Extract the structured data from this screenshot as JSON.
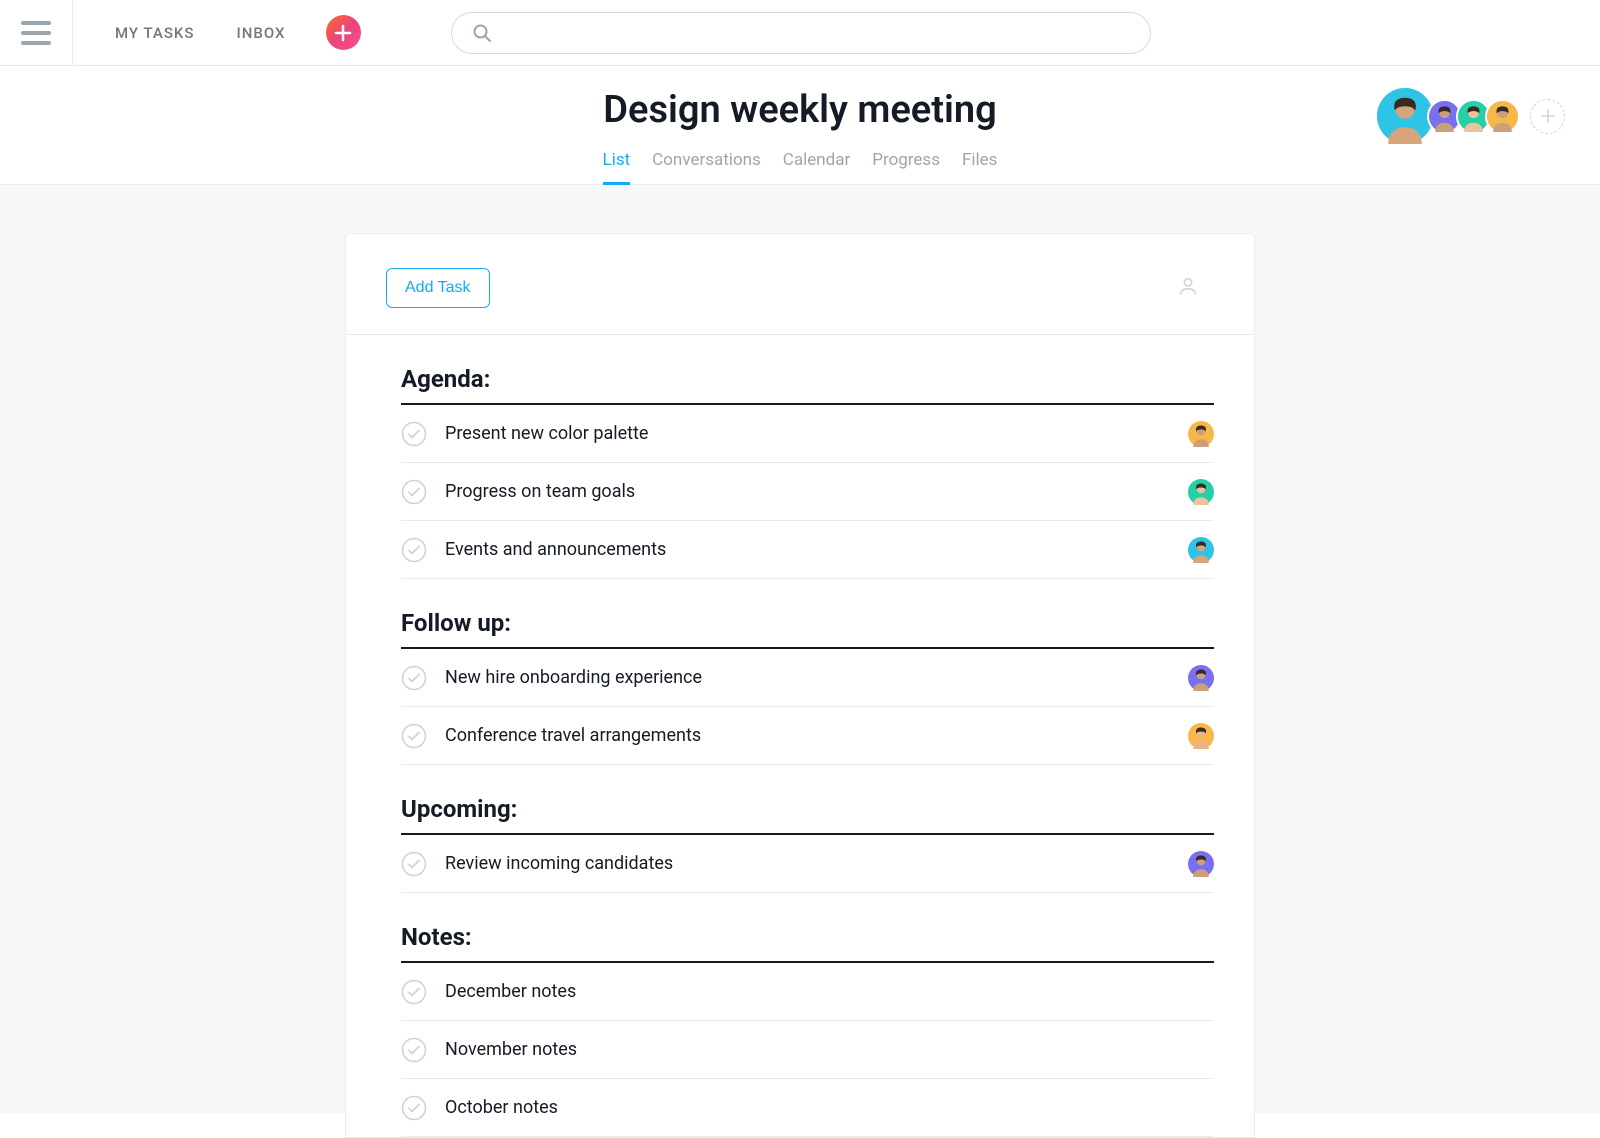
{
  "nav": {
    "my_tasks": "MY TASKS",
    "inbox": "INBOX"
  },
  "search": {
    "placeholder": ""
  },
  "project": {
    "title": "Design weekly meeting",
    "tabs": [
      "List",
      "Conversations",
      "Calendar",
      "Progress",
      "Files"
    ],
    "active_tab": 0
  },
  "members": [
    {
      "color": "#2ec4e6",
      "skin": "#d6a57b"
    },
    {
      "color": "#7a6ff0",
      "skin": "#caa07a"
    },
    {
      "color": "#25d0a9",
      "skin": "#eac39a"
    },
    {
      "color": "#f7b84a",
      "skin": "#caa07a"
    }
  ],
  "add_task_label": "Add Task",
  "sections": [
    {
      "title": "Agenda:",
      "tasks": [
        {
          "title": "Present new color palette",
          "avatar_bg": "#f7b84a",
          "avatar_skin": "#caa07a"
        },
        {
          "title": "Progress on team goals",
          "avatar_bg": "#25d0a9",
          "avatar_skin": "#eac39a"
        },
        {
          "title": "Events and announcements",
          "avatar_bg": "#2ec4e6",
          "avatar_skin": "#d6a57b"
        }
      ]
    },
    {
      "title": "Follow up:",
      "tasks": [
        {
          "title": "New hire onboarding experience",
          "avatar_bg": "#7a6ff0",
          "avatar_skin": "#caa07a"
        },
        {
          "title": "Conference travel arrangements",
          "avatar_bg": "#f7b84a",
          "avatar_skin": "#e8b28a"
        }
      ]
    },
    {
      "title": "Upcoming:",
      "tasks": [
        {
          "title": "Review incoming candidates",
          "avatar_bg": "#7a6ff0",
          "avatar_skin": "#caa07a"
        }
      ]
    },
    {
      "title": "Notes:",
      "tasks": [
        {
          "title": "December notes",
          "avatar_bg": null,
          "avatar_skin": null
        },
        {
          "title": "November notes",
          "avatar_bg": null,
          "avatar_skin": null
        },
        {
          "title": "October notes",
          "avatar_bg": null,
          "avatar_skin": null
        }
      ]
    }
  ]
}
